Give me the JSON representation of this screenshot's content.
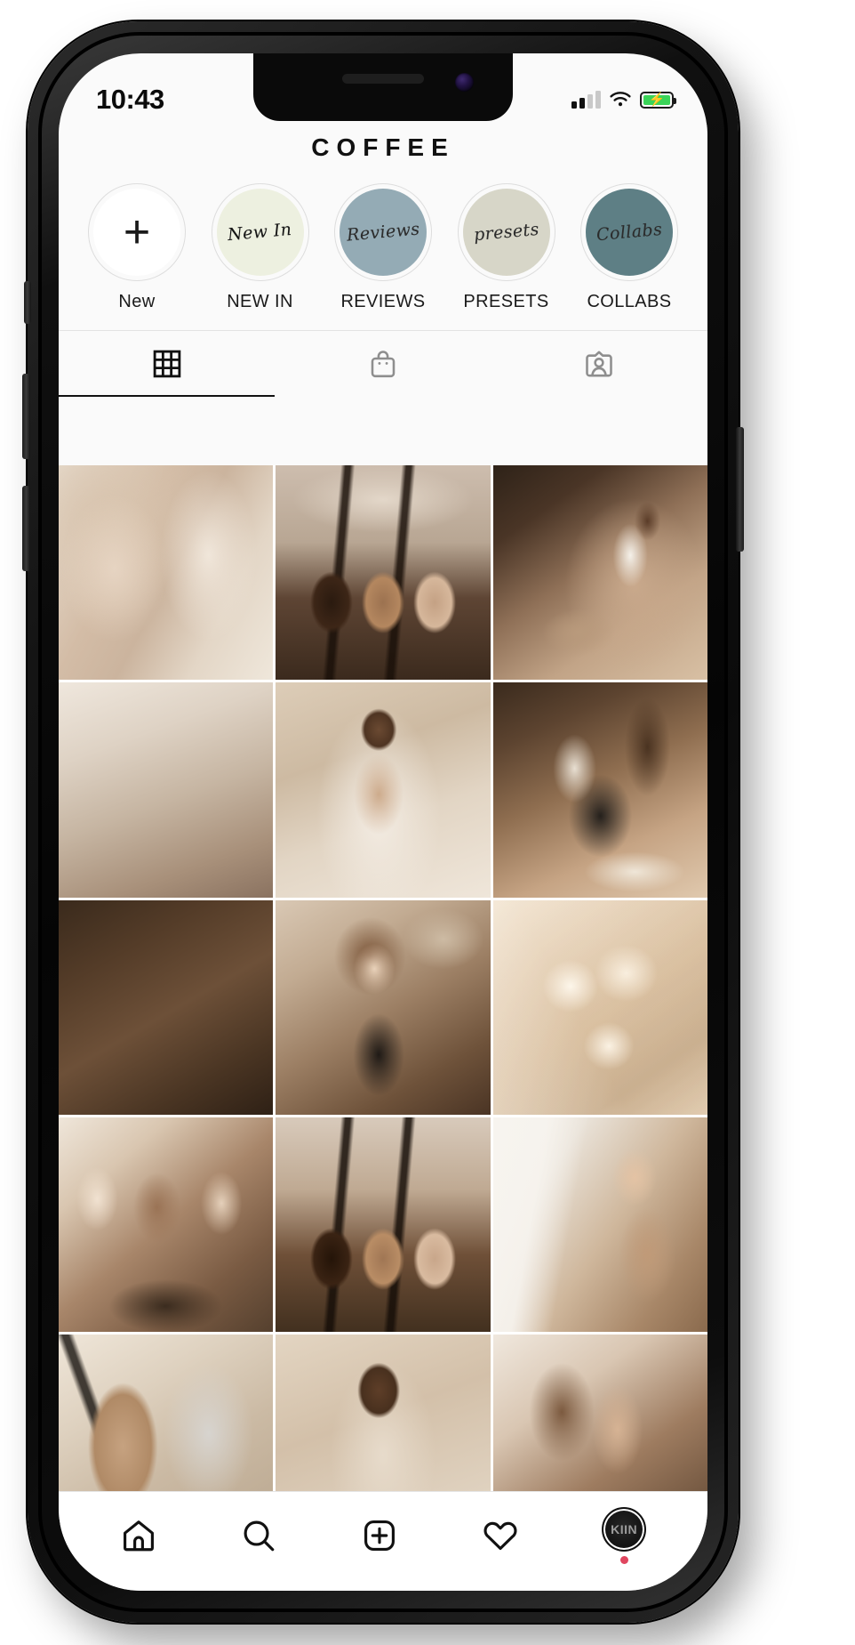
{
  "status_bar": {
    "time": "10:43",
    "signal_icon": "cellular-signal-icon",
    "wifi_icon": "wifi-icon",
    "battery_icon": "battery-charging-icon"
  },
  "header": {
    "title": "COFFEE"
  },
  "highlights": [
    {
      "label": "New",
      "script": "",
      "fill": "#ffffff",
      "icon": "plus-icon",
      "is_add": true
    },
    {
      "label": "NEW IN",
      "script": "New In",
      "fill": "#edf0e0",
      "icon": "highlight-cover-new-in",
      "is_add": false
    },
    {
      "label": "REVIEWS",
      "script": "Reviews",
      "fill": "#94abb5",
      "icon": "highlight-cover-reviews",
      "is_add": false
    },
    {
      "label": "PRESETS",
      "script": "presets",
      "fill": "#d7d6c8",
      "icon": "highlight-cover-presets",
      "is_add": false
    },
    {
      "label": "COLLABS",
      "script": "Collabs",
      "fill": "#5e7f85",
      "icon": "highlight-cover-collabs",
      "is_add": false
    }
  ],
  "profile_tabs": [
    {
      "name": "grid",
      "icon": "grid-icon",
      "active": true
    },
    {
      "name": "shop",
      "icon": "shopping-bag-icon",
      "active": false
    },
    {
      "name": "tagged",
      "icon": "tagged-photos-icon",
      "active": false
    }
  ],
  "grid": {
    "columns": 3,
    "posts": [
      {
        "alt": "hands with rings and beige dress",
        "art": "p-hands"
      },
      {
        "alt": "three coffee glasses on wood",
        "art": "p-coffee3"
      },
      {
        "alt": "woman in white swimsuit on sand",
        "art": "p-beach"
      },
      {
        "alt": "two iced coffee cups held up",
        "art": "p-icedcoffee"
      },
      {
        "alt": "woman in white backless dress",
        "art": "p-dress"
      },
      {
        "alt": "woman holding glass of water",
        "art": "p-water"
      },
      {
        "alt": "espresso cup on dark wood flatlay",
        "art": "p-espresso"
      },
      {
        "alt": "portrait of woman in black dress",
        "art": "p-portrait"
      },
      {
        "alt": "close-up iced coffee with ice cubes",
        "art": "p-ice"
      },
      {
        "alt": "three women portrait close-up",
        "art": "p-faces"
      },
      {
        "alt": "three coffee glasses on wood",
        "art": "p-trio2"
      },
      {
        "alt": "woman by white curtain in light",
        "art": "p-light"
      },
      {
        "alt": "iced coffee cup from above",
        "art": "p-cup-top"
      },
      {
        "alt": "woman from behind on sand",
        "art": "p-back"
      },
      {
        "alt": "woman with long hair side profile",
        "art": "p-girl2"
      }
    ]
  },
  "bottom_nav": [
    {
      "name": "home",
      "icon": "home-icon",
      "active": true
    },
    {
      "name": "search",
      "icon": "search-icon",
      "active": false
    },
    {
      "name": "create",
      "icon": "add-post-icon",
      "active": false
    },
    {
      "name": "activity",
      "icon": "heart-icon",
      "active": false
    },
    {
      "name": "profile",
      "icon": "profile-avatar-icon",
      "active": false,
      "avatar_text": "KIIN",
      "badge": true
    }
  ],
  "colors": {
    "accent_badge": "#e0465f",
    "screen_bg": "#fafafa",
    "icon_inactive": "#8e8e8e",
    "icon_active": "#111111"
  }
}
